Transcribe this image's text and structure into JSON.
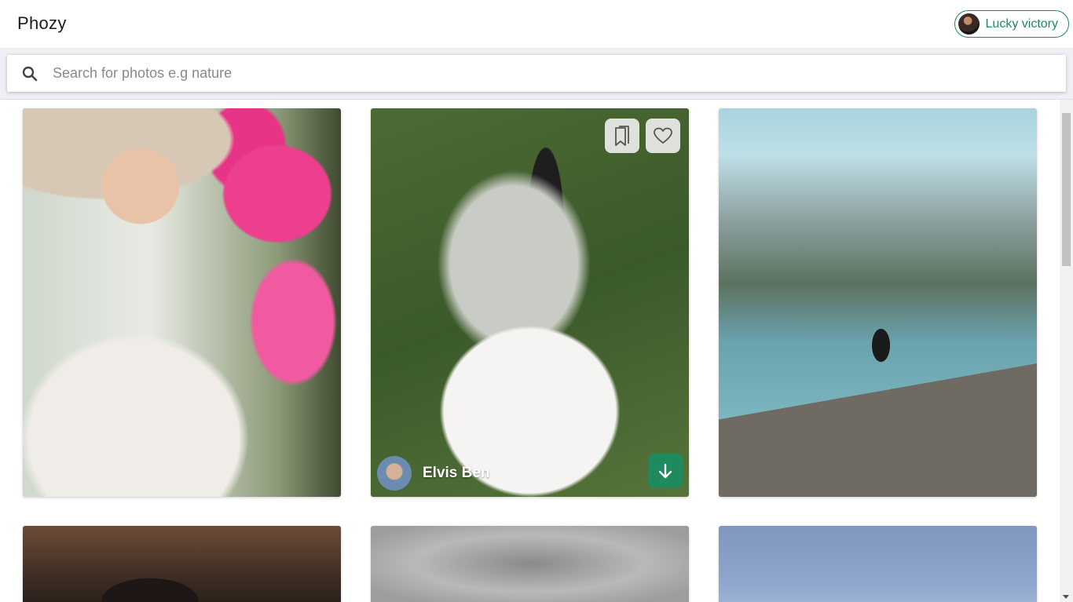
{
  "app": {
    "title": "Phozy"
  },
  "user": {
    "name": "Lucky victory",
    "avatar_icon": "user-avatar"
  },
  "search": {
    "placeholder": "Search for photos e.g nature",
    "value": ""
  },
  "photos": [
    {
      "id": "portrait-flowers"
    },
    {
      "id": "wedding-couple",
      "author": "Elvis Ben",
      "actions": [
        "bookmark-icon",
        "heart-icon",
        "download-arrow-icon"
      ]
    },
    {
      "id": "lake-pier"
    },
    {
      "id": "bride-interior"
    },
    {
      "id": "blurred-gray"
    },
    {
      "id": "blue-sky-water"
    }
  ],
  "colors": {
    "accent": "#1e8a5e",
    "search_bg": "#eef0f5"
  }
}
